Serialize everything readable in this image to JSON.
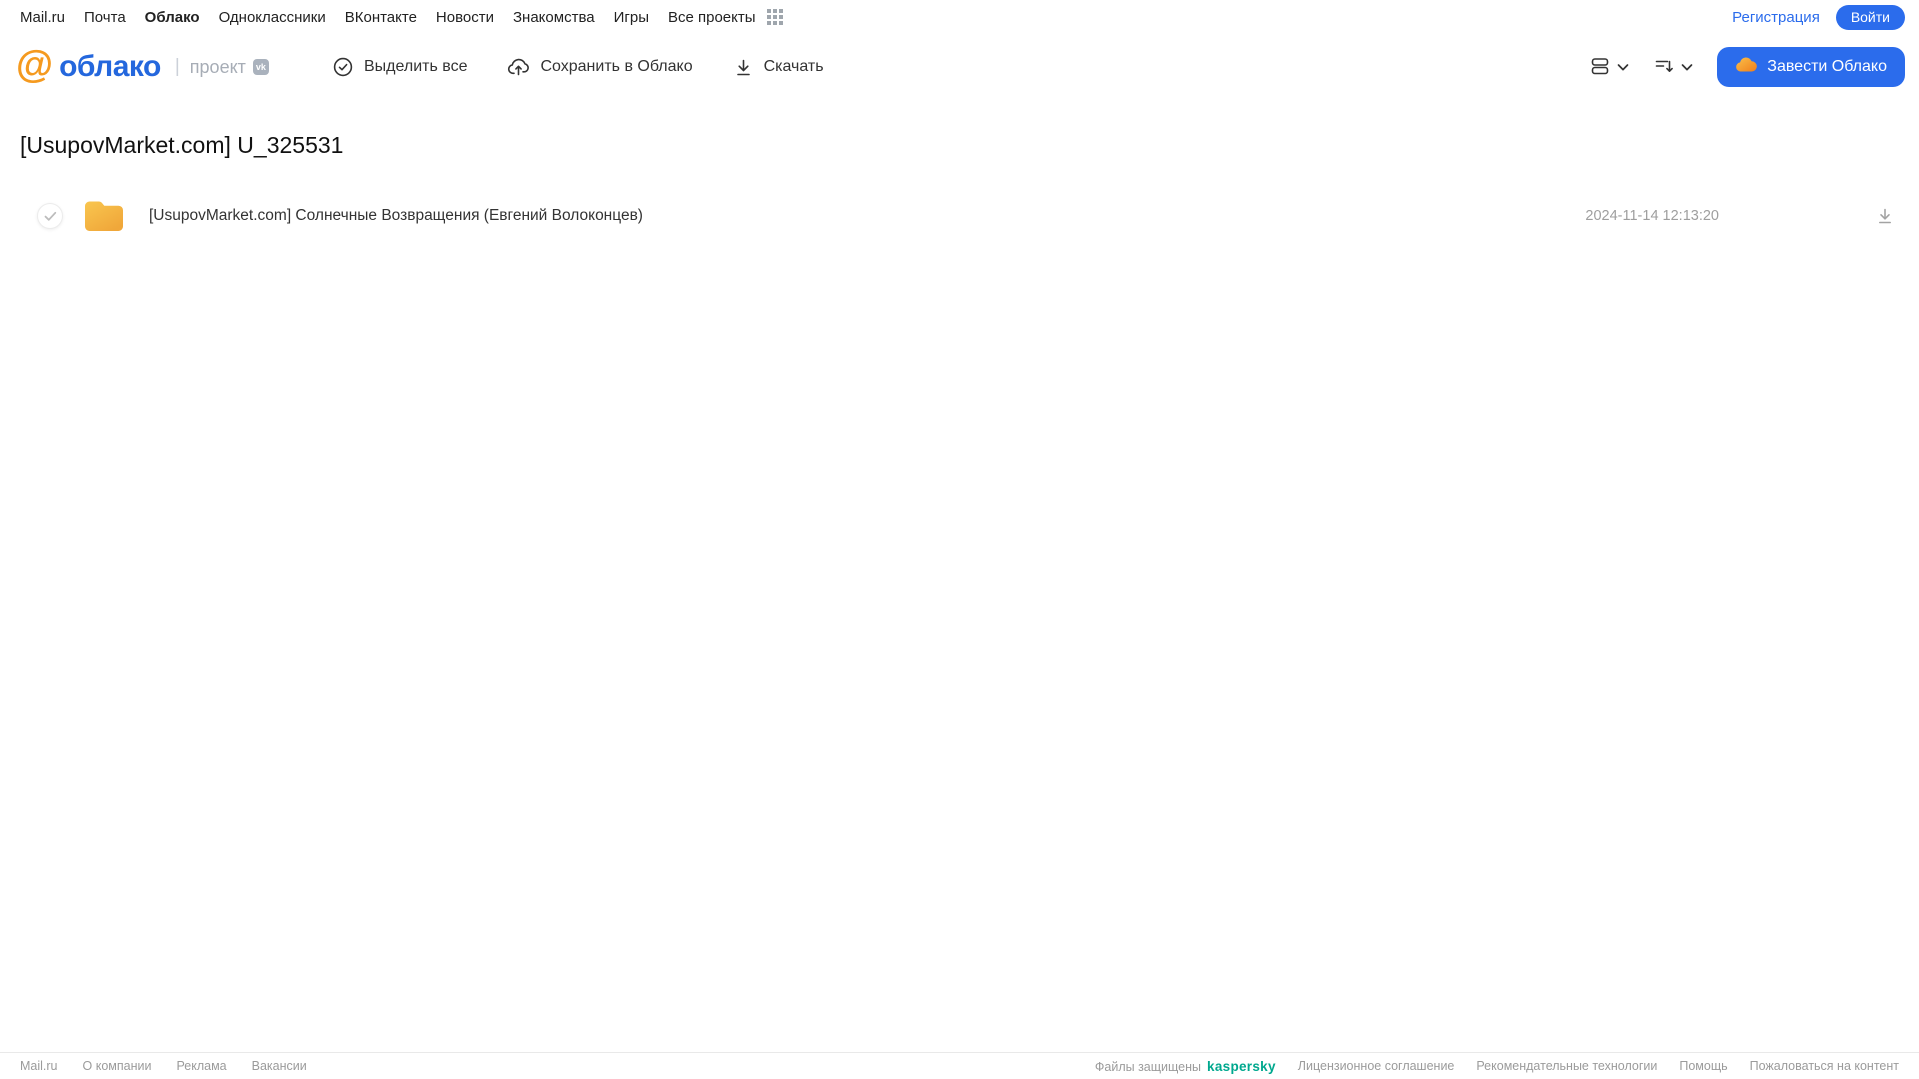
{
  "top_nav": {
    "items": [
      "Mail.ru",
      "Почта",
      "Облако",
      "Одноклассники",
      "ВКонтакте",
      "Новости",
      "Знакомства",
      "Игры",
      "Все проекты"
    ],
    "active_item": "Облако",
    "registration_label": "Регистрация",
    "login_label": "Войти"
  },
  "header": {
    "logo": {
      "at_symbol": "@",
      "word": "облако",
      "separator": "|",
      "project_label": "проект",
      "vk_badge": "vk"
    },
    "toolbar": {
      "select_all_label": "Выделить все",
      "save_to_cloud_label": "Сохранить в Облако",
      "download_label": "Скачать"
    },
    "get_cloud_label": "Завести Облако"
  },
  "main": {
    "title": "[UsupovMarket.com] U_325531",
    "files": [
      {
        "type": "folder",
        "name": "[UsupovMarket.com] Солнечные Возвращения (Евгений Волоконцев)",
        "modified": "2024-11-14 12:13:20"
      }
    ]
  },
  "footer": {
    "left_links": [
      "Mail.ru",
      "О компании",
      "Реклама",
      "Вакансии"
    ],
    "protected_label": "Файлы защищены",
    "kaspersky_label": "kaspersky",
    "right_links": [
      "Лицензионное соглашение",
      "Рекомендательные технологии",
      "Помощь",
      "Пожаловаться на контент"
    ]
  },
  "colors": {
    "accent_blue": "#2b6cec",
    "logo_blue": "#2467dd",
    "logo_orange": "#f59a1f",
    "folder_yellow_top": "#f9c64f",
    "folder_yellow_bottom": "#f0a73a",
    "kaspersky_teal": "#00a88e",
    "muted_gray": "#9b9b9b",
    "text_dark": "#333333"
  },
  "icons": {
    "apps-grid-icon": "3x3-dot-grid",
    "mailru-at-icon": "@",
    "vk-icon": "vk-badge",
    "select-all-icon": "circled-check",
    "save-to-cloud-icon": "cloud-with-up-arrow",
    "download-icon": "arrow-down-over-line",
    "view-mode-icon": "stacked-rows",
    "sort-icon": "lines-with-down-arrow",
    "chevron-down-icon": "chevron-down",
    "cloud-icon": "orange-cloud",
    "folder-icon": "yellow-folder",
    "row-check-icon": "gray-check"
  }
}
